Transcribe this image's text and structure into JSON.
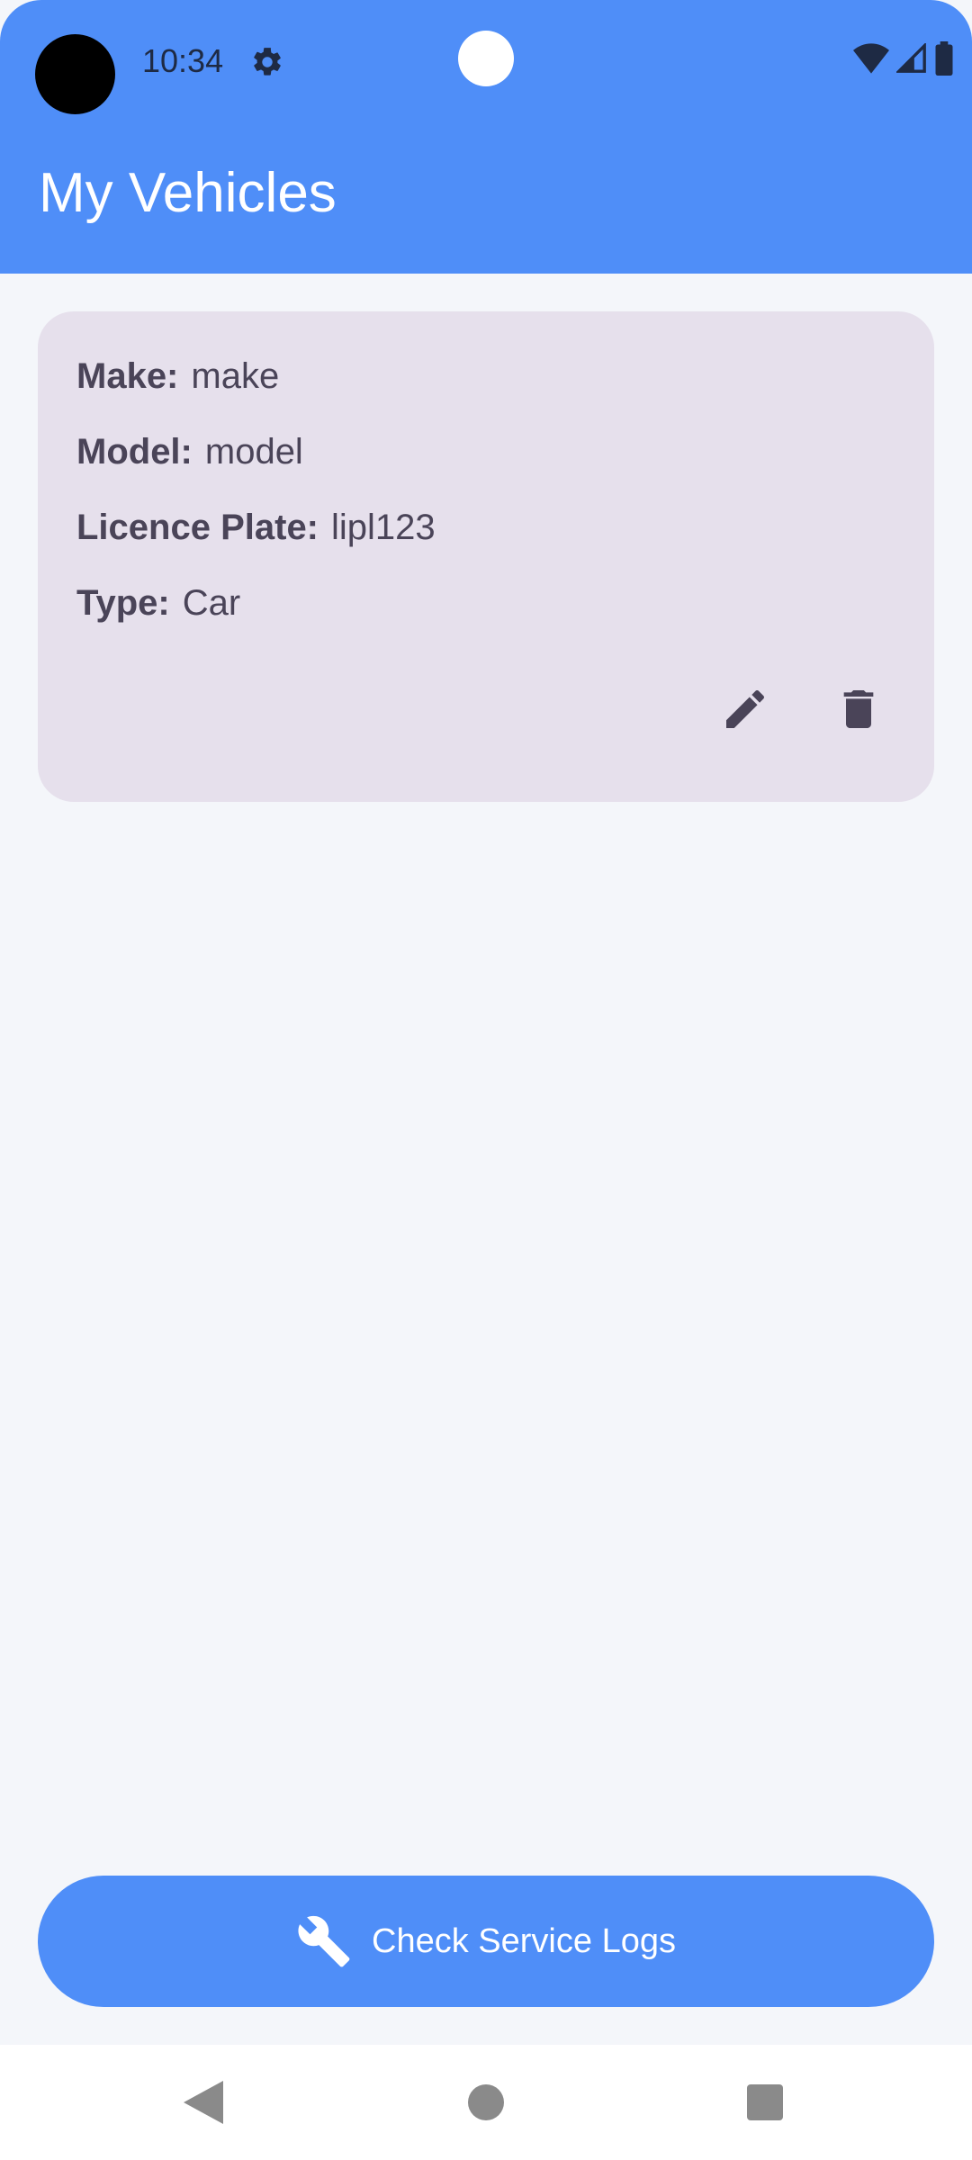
{
  "status_bar": {
    "time": "10:34",
    "icons": [
      "camera-dot",
      "gear-icon",
      "wifi-icon",
      "signal-icon",
      "battery-icon"
    ]
  },
  "app_bar": {
    "title": "My Vehicles"
  },
  "vehicle": {
    "make_label": "Make:",
    "make_value": "make",
    "model_label": "Model:",
    "model_value": "model",
    "plate_label": "Licence Plate:",
    "plate_value": "lipl123",
    "type_label": "Type:",
    "type_value": "Car",
    "actions": [
      "edit-icon",
      "delete-icon"
    ]
  },
  "service_button": {
    "label": "Check Service Logs",
    "icon": "wrench-icon"
  },
  "nav_bar": {
    "items": [
      "back",
      "home",
      "recents"
    ]
  },
  "colors": {
    "primary": "#4f8ef8",
    "card": "#e6e0ec",
    "background": "#f4f6fa",
    "card_text": "#4a4458"
  }
}
